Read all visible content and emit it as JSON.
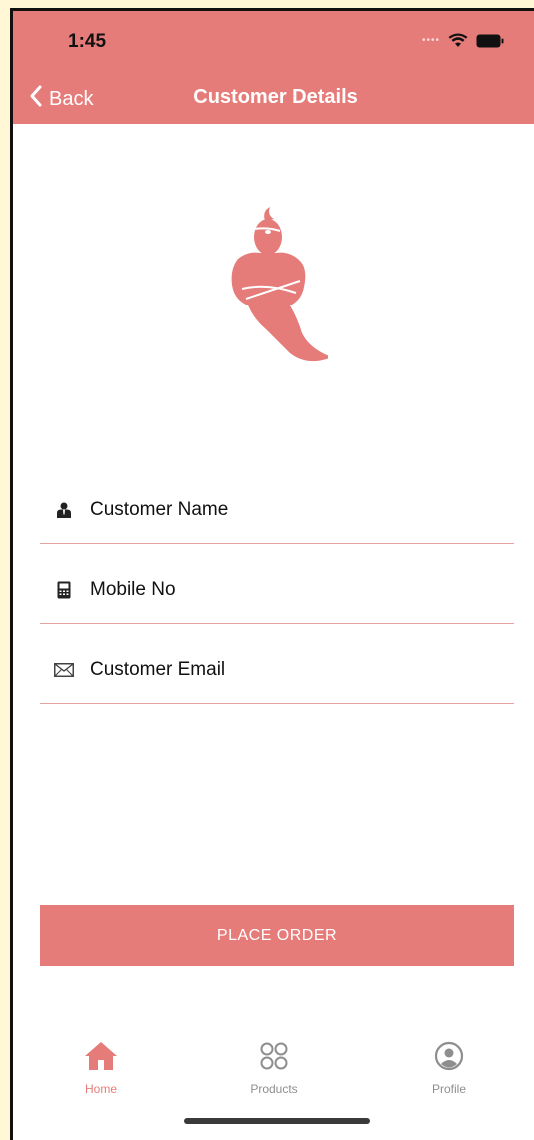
{
  "status": {
    "time": "1:45"
  },
  "nav": {
    "back_label": "Back",
    "title": "Customer Details"
  },
  "form": {
    "name_placeholder": "Customer Name",
    "mobile_placeholder": "Mobile No",
    "email_placeholder": "Customer Email"
  },
  "actions": {
    "place_order": "PLACE ORDER"
  },
  "tabs": [
    {
      "label": "Home",
      "icon": "home-icon",
      "active": true
    },
    {
      "label": "Products",
      "icon": "grid-circles-icon",
      "active": false
    },
    {
      "label": "Profile",
      "icon": "profile-circle-icon",
      "active": false
    }
  ],
  "colors": {
    "accent": "#e57c7a",
    "inactive": "#8e8e8e"
  }
}
